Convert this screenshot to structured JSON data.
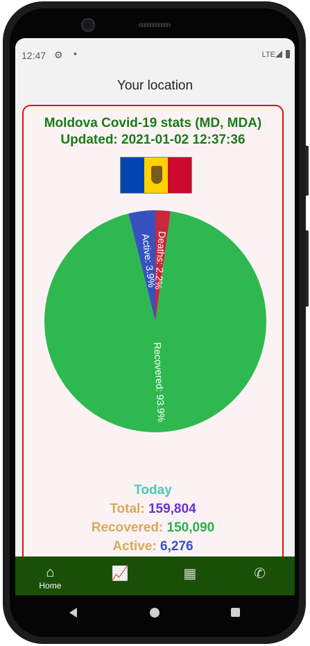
{
  "status_bar": {
    "time": "12:47",
    "network": "LTE"
  },
  "header": {
    "title": "Your location"
  },
  "card": {
    "title": "Moldova Covid-19 stats (MD, MDA)",
    "updated": "Updated: 2021-01-02 12:37:36",
    "flag_colors": [
      "#0046ae",
      "#ffd200",
      "#cc092f"
    ]
  },
  "chart_data": {
    "type": "pie",
    "slices": [
      {
        "label": "Recovered: 93.9%",
        "value": 93.9,
        "color": "#2fb84f"
      },
      {
        "label": "Deaths: 2.2%",
        "value": 2.2,
        "color": "#c8283a"
      },
      {
        "label": "Active: 3.9%",
        "value": 3.9,
        "color": "#3552c0"
      }
    ]
  },
  "stats": {
    "heading": "Today",
    "total_label": "Total:",
    "total_value": "159,804",
    "recovered_label": "Recovered:",
    "recovered_value": "150,090",
    "active_label": "Active:",
    "active_value": "6,276"
  },
  "nav": {
    "items": [
      {
        "label": "Home",
        "icon": "home-icon"
      },
      {
        "label": "",
        "icon": "chart-icon"
      },
      {
        "label": "",
        "icon": "table-icon"
      },
      {
        "label": "",
        "icon": "phone-icon"
      }
    ]
  }
}
